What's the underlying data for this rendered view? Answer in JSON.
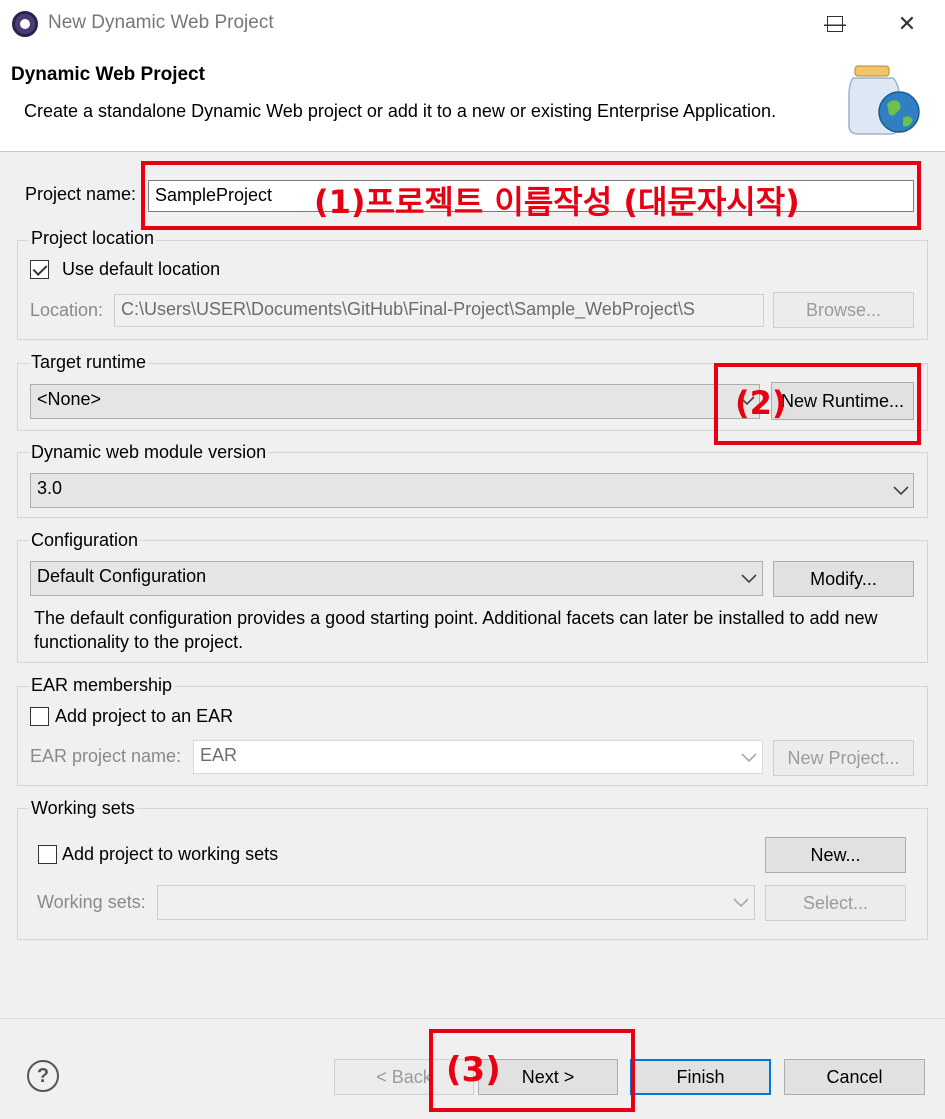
{
  "window": {
    "title": "New Dynamic Web Project",
    "minimize_glyph": "—",
    "maximize_glyph": "☐",
    "close_glyph": "✕"
  },
  "header": {
    "title": "Dynamic Web Project",
    "description": "Create a standalone Dynamic Web project or add it to a new or existing Enterprise Application."
  },
  "project_name": {
    "label": "Project name:",
    "value": "SampleProject"
  },
  "project_location": {
    "group_title": "Project location",
    "use_default_label": "Use default location",
    "use_default_checked": true,
    "location_label": "Location:",
    "location_value": "C:\\Users\\USER\\Documents\\GitHub\\Final-Project\\Sample_WebProject\\S",
    "browse_label": "Browse..."
  },
  "target_runtime": {
    "group_title": "Target runtime",
    "selected": "<None>",
    "new_runtime_label": "New Runtime..."
  },
  "module_version": {
    "group_title": "Dynamic web module version",
    "selected": "3.0"
  },
  "configuration": {
    "group_title": "Configuration",
    "selected": "Default Configuration",
    "modify_label": "Modify...",
    "description": "The default configuration provides a good starting point. Additional facets can later be installed to add new functionality to the project."
  },
  "ear_membership": {
    "group_title": "EAR membership",
    "add_label": "Add project to an EAR",
    "add_checked": false,
    "ear_name_label": "EAR project name:",
    "ear_name_value": "EAR",
    "new_project_label": "New Project..."
  },
  "working_sets": {
    "group_title": "Working sets",
    "add_label": "Add project to working sets",
    "add_checked": false,
    "new_label": "New...",
    "sets_label": "Working sets:",
    "select_label": "Select..."
  },
  "footer": {
    "help_glyph": "?",
    "back_label": "< Back",
    "next_label": "Next >",
    "finish_label": "Finish",
    "cancel_label": "Cancel"
  },
  "annotations": {
    "step1": "(1)프로젝트 이름작성 (대문자시작)",
    "step2": "(2)",
    "step3": "(3)",
    "color": "#e60012"
  },
  "icons": {
    "app": "eclipse-icon",
    "header": "web-project-jar-icon",
    "help": "help-icon"
  }
}
